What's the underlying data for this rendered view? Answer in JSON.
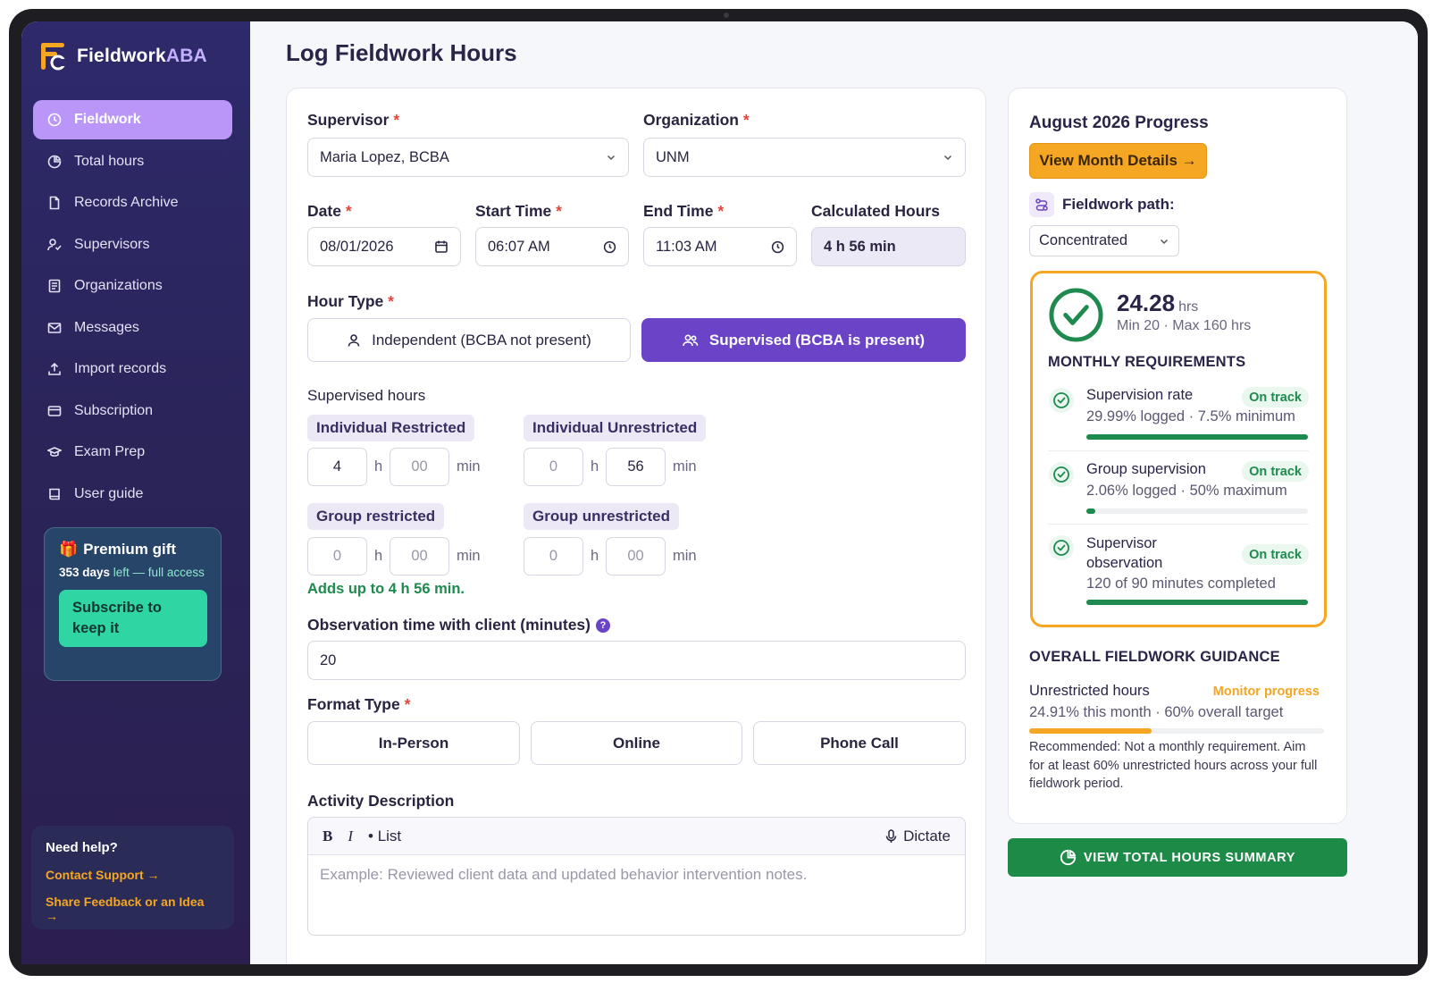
{
  "brand": {
    "name_main": "Fieldwork",
    "name_accent": "ABA"
  },
  "sidebar": {
    "items": [
      {
        "label": "Fieldwork",
        "icon": "clock-icon",
        "active": true
      },
      {
        "label": "Total hours",
        "icon": "pie-chart-icon"
      },
      {
        "label": "Records Archive",
        "icon": "document-icon"
      },
      {
        "label": "Supervisors",
        "icon": "user-check-icon"
      },
      {
        "label": "Organizations",
        "icon": "list-document-icon"
      },
      {
        "label": "Messages",
        "icon": "mail-icon"
      },
      {
        "label": "Import records",
        "icon": "upload-icon"
      },
      {
        "label": "Subscription",
        "icon": "card-icon"
      },
      {
        "label": "Exam Prep",
        "icon": "graduation-cap-icon"
      },
      {
        "label": "User guide",
        "icon": "book-icon"
      }
    ],
    "premium": {
      "title": "Premium gift",
      "days": "353 days",
      "days_suffix": " left — full access",
      "button": "Subscribe to keep it"
    },
    "help": {
      "title": "Need help?",
      "contact": "Contact Support →",
      "feedback": "Share Feedback or an Idea →"
    }
  },
  "page": {
    "title": "Log Fieldwork Hours"
  },
  "form": {
    "supervisor": {
      "label": "Supervisor",
      "value": "Maria Lopez, BCBA"
    },
    "organization": {
      "label": "Organization",
      "value": "UNM"
    },
    "date": {
      "label": "Date",
      "value": "08/01/2026"
    },
    "start_time": {
      "label": "Start Time",
      "value": "06:07 AM"
    },
    "end_time": {
      "label": "End Time",
      "value": "11:03 AM"
    },
    "calculated": {
      "label": "Calculated Hours",
      "value": "4 h 56 min"
    },
    "hour_type": {
      "label": "Hour Type",
      "independent": "Independent (BCBA not present)",
      "supervised": "Supervised (BCBA is present)",
      "selected": "supervised"
    },
    "supervised_hours": {
      "label": "Supervised hours",
      "individual_restricted": {
        "label": "Individual Restricted",
        "h": "4",
        "min": "00"
      },
      "individual_unrestricted": {
        "label": "Individual Unrestricted",
        "h": "0",
        "min": "56"
      },
      "group_restricted": {
        "label": "Group restricted",
        "h": "0",
        "min": "00"
      },
      "group_unrestricted": {
        "label": "Group unrestricted",
        "h": "0",
        "min": "00"
      },
      "unit_h": "h",
      "unit_min": "min",
      "total_note": "Adds up to 4 h 56 min."
    },
    "observation": {
      "label": "Observation time with client (minutes)",
      "value": "20",
      "help": "?"
    },
    "format": {
      "label": "Format Type",
      "options": [
        "In-Person",
        "Online",
        "Phone Call"
      ]
    },
    "activity": {
      "label": "Activity Description",
      "bold": "B",
      "italic": "I",
      "list": "• List",
      "dictate": "Dictate",
      "placeholder": "Example: Reviewed client data and updated behavior intervention notes."
    }
  },
  "progress": {
    "title": "August 2026 Progress",
    "month_button": "View Month Details →",
    "path_label": "Fieldwork path:",
    "path_value": "Concentrated",
    "hours": "24.28",
    "hours_unit": "hrs",
    "hours_range": "Min 20 · Max 160 hrs",
    "monthly_title": "MONTHLY REQUIREMENTS",
    "requirements": [
      {
        "title": "Supervision rate",
        "detail": "29.99% logged · 7.5% minimum",
        "status": "On track",
        "progress": 1.0
      },
      {
        "title": "Group supervision",
        "detail": "2.06% logged · 50% maximum",
        "status": "On track",
        "progress": 0.04
      },
      {
        "title": "Supervisor observation",
        "title_line1": "Supervisor",
        "title_line2": "observation",
        "detail": "120 of 90 minutes completed",
        "status": "On track",
        "progress": 1.0
      }
    ],
    "overall_title": "OVERALL FIELDWORK GUIDANCE",
    "unrestricted_label": "Unrestricted hours",
    "unrestricted_status": "Monitor progress",
    "unrestricted_detail": "24.91% this month · 60% overall target",
    "unrestricted_progress": 0.4151,
    "recommendation": "Recommended: Not a monthly requirement. Aim for at least 60% unrestricted hours across your full fieldwork period."
  },
  "summary_button": "VIEW TOTAL HOURS SUMMARY",
  "colors": {
    "accent_purple": "#6a43c7",
    "active_nav": "#b996f8",
    "orange": "#f5a623",
    "green": "#1e8a48",
    "teal": "#2fd6a4",
    "sidebar_bg": "#2e2a6b"
  }
}
